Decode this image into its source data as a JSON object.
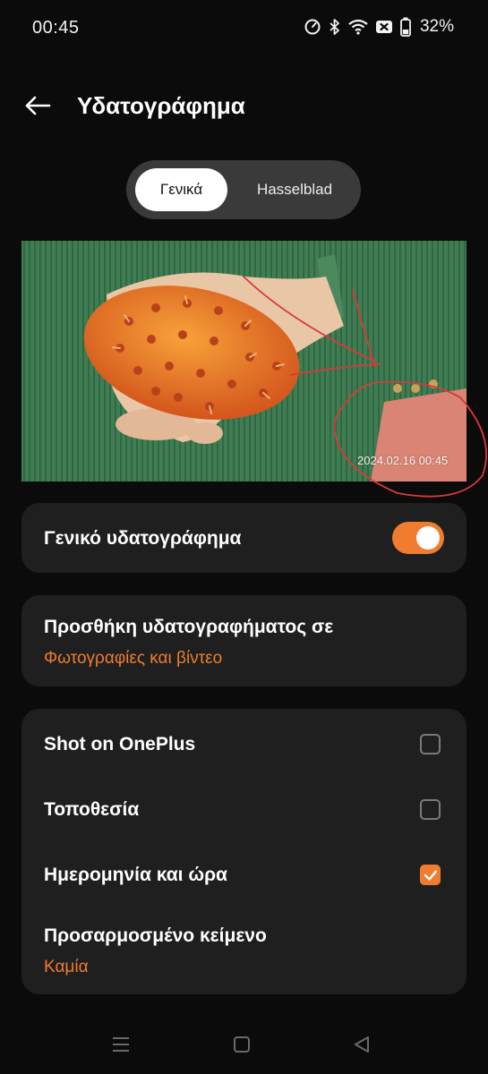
{
  "status_bar": {
    "time": "00:45",
    "battery_percent": "32%",
    "icons": [
      "speedometer-icon",
      "bluetooth-icon",
      "wifi-icon",
      "nfc-icon",
      "battery-icon"
    ]
  },
  "header": {
    "title": "Υδατογράφημα",
    "back_icon": "arrow-left-icon"
  },
  "tabs": [
    {
      "label": "Γενικά",
      "selected": true
    },
    {
      "label": "Hasselblad",
      "selected": false
    }
  ],
  "preview": {
    "watermark_text": "2024.02.16 00:45"
  },
  "general_watermark": {
    "label": "Γενικό υδατογράφημα",
    "enabled": true
  },
  "apply_to": {
    "label": "Προσθήκη υδατογραφήματος σε",
    "value": "Φωτογραφίες και βίντεο"
  },
  "options": {
    "shot_on": {
      "label": "Shot on OnePlus",
      "checked": false
    },
    "location": {
      "label": "Τοποθεσία",
      "checked": false
    },
    "datetime": {
      "label": "Ημερομηνία και ώρα",
      "checked": true
    },
    "custom_text": {
      "label": "Προσαρμοσμένο κείμενο",
      "value": "Καμία"
    }
  },
  "colors": {
    "accent": "#f07c2f",
    "background": "#0b0b0b",
    "card": "#1f1f1f"
  },
  "navbar": [
    "menu-icon",
    "home-icon",
    "back-triangle-icon"
  ]
}
